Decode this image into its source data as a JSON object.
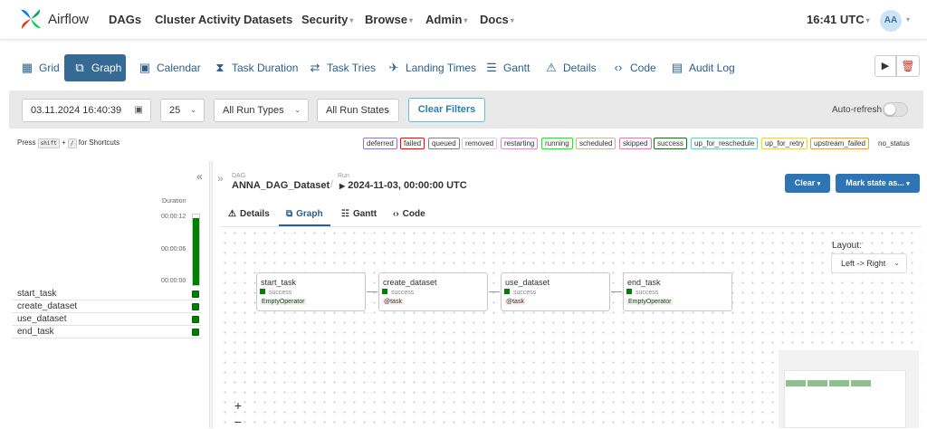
{
  "navbar": {
    "brand": "Airflow",
    "items": [
      "DAGs",
      "Cluster Activity",
      "Datasets",
      "Security",
      "Browse",
      "Admin",
      "Docs"
    ],
    "clock": "16:41 UTC",
    "avatar": "AA"
  },
  "view_tabs": [
    "Grid",
    "Graph",
    "Calendar",
    "Task Duration",
    "Task Tries",
    "Landing Times",
    "Gantt",
    "Details",
    "Code",
    "Audit Log"
  ],
  "active_view_tab": "Graph",
  "filters": {
    "date": "03.11.2024 16:40:39",
    "count": "25",
    "run_types": "All Run Types",
    "run_states": "All Run States",
    "clear_filters": "Clear Filters",
    "auto_refresh": "Auto-refresh",
    "auto_refresh_on": false
  },
  "shortcut": {
    "press": "Press",
    "key1": "shift",
    "plus": "+",
    "key2": "/",
    "suffix": "for Shortcuts"
  },
  "legend": [
    {
      "label": "deferred",
      "color": "#9370db"
    },
    {
      "label": "failed",
      "color": "#ff0000"
    },
    {
      "label": "queued",
      "color": "#808080"
    },
    {
      "label": "removed",
      "color": "#d3d3d3"
    },
    {
      "label": "restarting",
      "color": "#ee82ee"
    },
    {
      "label": "running",
      "color": "#00ff00"
    },
    {
      "label": "scheduled",
      "color": "#d2b48c"
    },
    {
      "label": "skipped",
      "color": "#ff69b4"
    },
    {
      "label": "success",
      "color": "#008000"
    },
    {
      "label": "up_for_reschedule",
      "color": "#40e0d0"
    },
    {
      "label": "up_for_retry",
      "color": "#ffd700"
    },
    {
      "label": "upstream_failed",
      "color": "#ffa500"
    },
    {
      "label": "no_status",
      "color": ""
    }
  ],
  "grid": {
    "duration_label": "Duration",
    "duration_ticks": [
      "00:00:12",
      "00:00:06",
      "00:00:00"
    ],
    "tasks": [
      "start_task",
      "create_dataset",
      "use_dataset",
      "end_task"
    ],
    "task_states": [
      "success",
      "success",
      "success",
      "success"
    ]
  },
  "details": {
    "dag_caption": "DAG",
    "dag_name": "ANNA_DAG_Dataset",
    "run_caption": "Run",
    "run_name": "2024-11-03, 00:00:00 UTC",
    "clear_button": "Clear",
    "mark_button": "Mark state as...",
    "tabs": [
      "Details",
      "Graph",
      "Gantt",
      "Code"
    ],
    "active_tab": "Graph"
  },
  "graph": {
    "layout_label": "Layout:",
    "layout_value": "Left -> Right",
    "nodes": [
      {
        "name": "start_task",
        "state": "success",
        "operator": "EmptyOperator",
        "op_color": "#e8f7e4"
      },
      {
        "name": "create_dataset",
        "state": "success",
        "operator": "@task",
        "op_color": "#ffefeb"
      },
      {
        "name": "use_dataset",
        "state": "success",
        "operator": "@task",
        "op_color": "#ffefeb"
      },
      {
        "name": "end_task",
        "state": "success",
        "operator": "EmptyOperator",
        "op_color": "#e8f7e4"
      }
    ],
    "zoom_in": "+",
    "zoom_out": "−"
  },
  "colors": {
    "accent": "#356a94",
    "primary_button": "#2e75b6",
    "success": "#008000"
  }
}
